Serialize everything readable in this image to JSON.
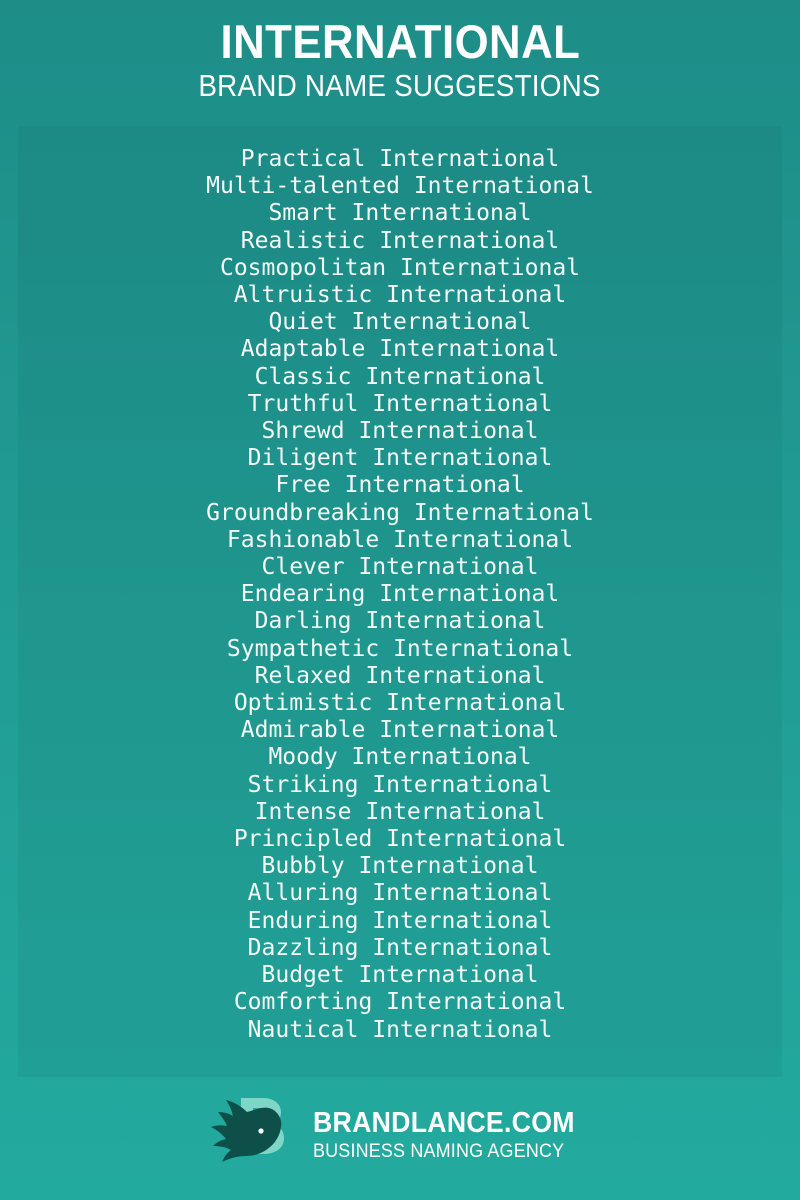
{
  "header": {
    "title": "INTERNATIONAL",
    "subtitle": "BRAND NAME SUGGESTIONS"
  },
  "colors": {
    "background_top": "#1e8d88",
    "background_bottom": "#23aa9f",
    "panel": "#1d8d87",
    "text": "#f4f8f7",
    "logo_bird": "#0e4f49",
    "logo_letter": "#7fd6c6"
  },
  "suggestions": [
    "Practical International",
    "Multi-talented International",
    "Smart International",
    "Realistic International",
    "Cosmopolitan International",
    "Altruistic International",
    "Quiet International",
    "Adaptable International",
    "Classic International",
    "Truthful International",
    "Shrewd International",
    "Diligent International",
    "Free International",
    "Groundbreaking International",
    "Fashionable International",
    "Clever International",
    "Endearing International",
    "Darling International",
    "Sympathetic International",
    "Relaxed International",
    "Optimistic International",
    "Admirable International",
    "Moody International",
    "Striking International",
    "Intense International",
    "Principled International",
    "Bubbly International",
    "Alluring International",
    "Enduring International",
    "Dazzling International",
    "Budget International",
    "Comforting International",
    "Nautical International"
  ],
  "footer": {
    "logo_icon": "bird-logo-icon",
    "brand": "BRANDLANCE.COM",
    "tagline": "BUSINESS NAMING AGENCY"
  }
}
